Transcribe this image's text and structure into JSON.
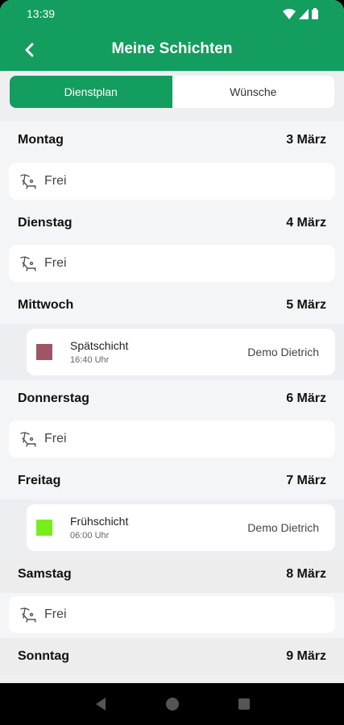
{
  "status": {
    "time": "13:39"
  },
  "appbar": {
    "title": "Meine Schichten"
  },
  "tabs": [
    {
      "label": "Dienstplan",
      "active": true
    },
    {
      "label": "Wünsche",
      "active": false
    }
  ],
  "days": [
    {
      "day": "Montag",
      "date": "3 März",
      "frei": "Frei"
    },
    {
      "day": "Dienstag",
      "date": "4 März",
      "frei": "Frei"
    },
    {
      "day": "Mittwoch",
      "date": "5 März",
      "shift": {
        "name": "Spätschicht",
        "time": "16:40 Uhr",
        "person": "Demo Dietrich",
        "color": "#a05566"
      }
    },
    {
      "day": "Donnerstag",
      "date": "6 März",
      "frei": "Frei"
    },
    {
      "day": "Freitag",
      "date": "7 März",
      "shift": {
        "name": "Frühschicht",
        "time": "06:00 Uhr",
        "person": "Demo Dietrich",
        "color": "#77ee1a"
      }
    },
    {
      "day": "Samstag",
      "date": "8 März",
      "frei": "Frei"
    },
    {
      "day": "Sonntag",
      "date": "9 März"
    }
  ],
  "colors": {
    "primary": "#139d5e",
    "background": "#eeeff1"
  },
  "icons": {
    "back": "back-arrow-icon",
    "frei": "lounger-icon",
    "wifi": "wifi-icon",
    "signal": "signal-icon",
    "battery": "battery-icon"
  }
}
